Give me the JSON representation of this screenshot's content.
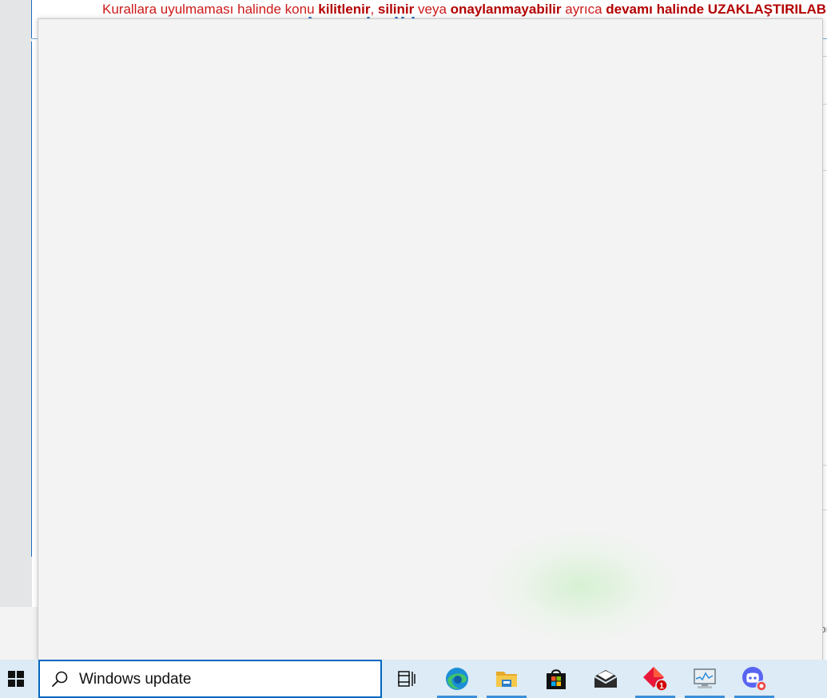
{
  "background_page": {
    "notice": {
      "part1": "Kurallara uyulmaması halinde konu ",
      "bold1": "kilitlenir",
      "sep1": ", ",
      "bold2": "silinir",
      "part2": " veya ",
      "bold3": "onaylanmayabilir",
      "part3": " ayrıca ",
      "bold4": "devamı halinde UZAKLAŞTIRILAB"
    },
    "edge_char": "ɔı"
  },
  "taskbar": {
    "search": {
      "value": "Windows update",
      "icon": "search-icon"
    },
    "icons": [
      {
        "name": "task-view-icon",
        "active": false
      },
      {
        "name": "edge-icon",
        "active": true
      },
      {
        "name": "file-explorer-icon",
        "active": true
      },
      {
        "name": "microsoft-store-icon",
        "active": false
      },
      {
        "name": "mail-icon",
        "active": false
      },
      {
        "name": "app-badge-icon",
        "badge": "1",
        "active": true
      },
      {
        "name": "task-manager-icon",
        "active": true
      },
      {
        "name": "discord-icon",
        "active": true
      }
    ]
  },
  "colors": {
    "notice_red": "#cc1a1a",
    "accent_blue": "#0067c0",
    "taskbar_bg": "#dcebf5"
  }
}
